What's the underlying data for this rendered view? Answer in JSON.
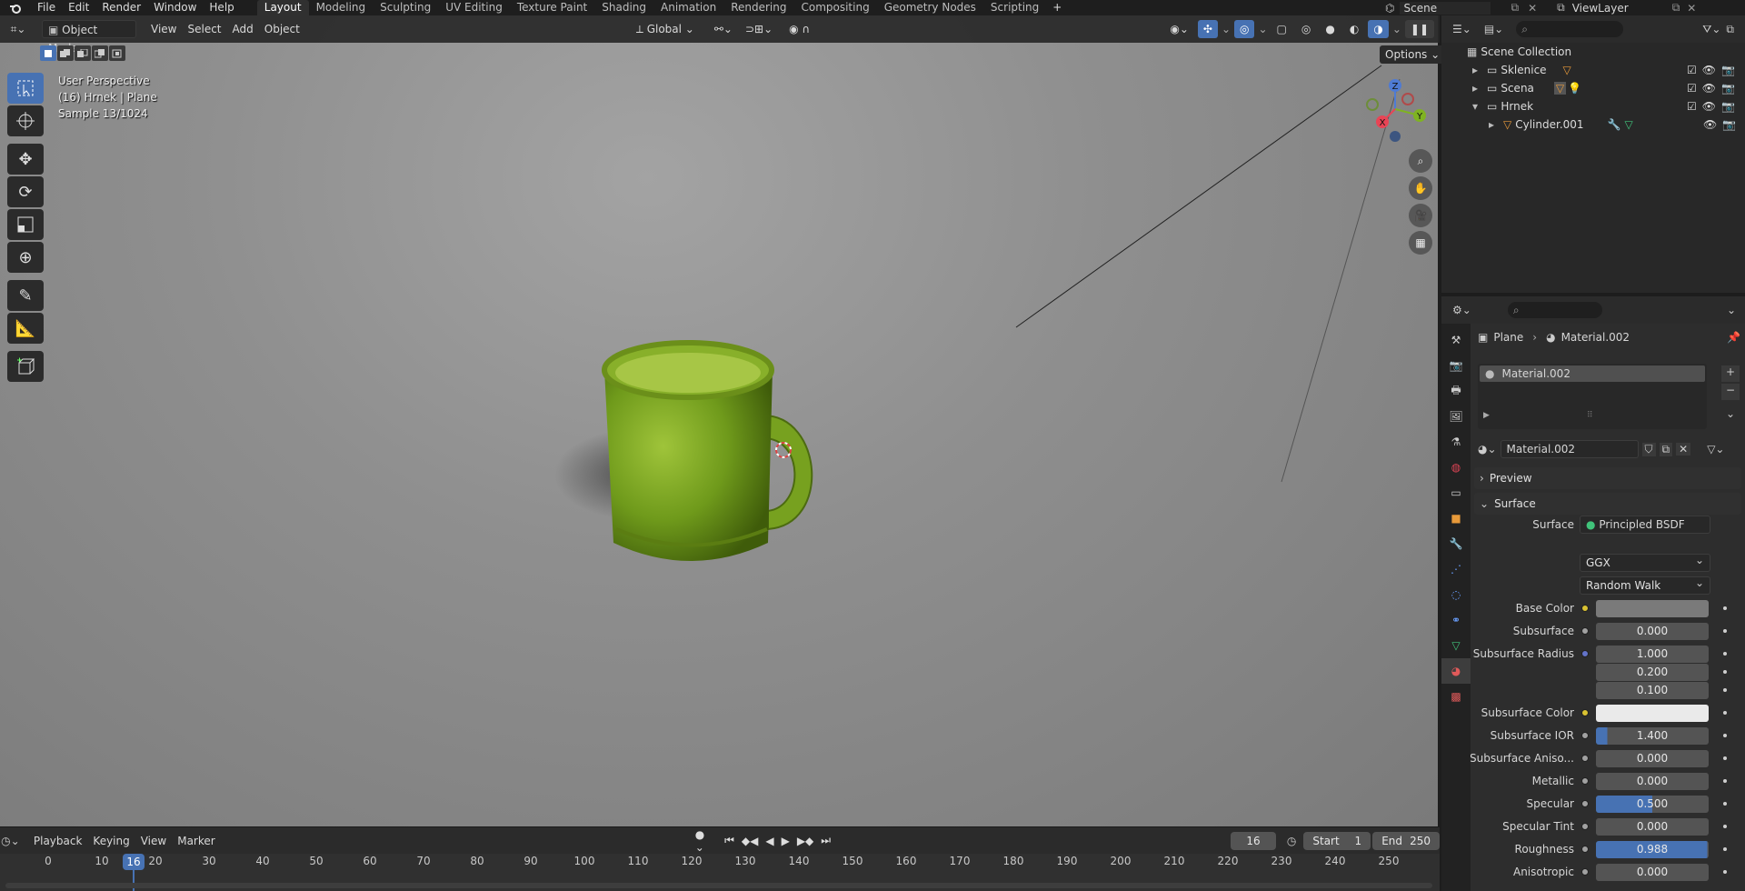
{
  "topbar": {
    "menu": [
      "File",
      "Edit",
      "Render",
      "Window",
      "Help"
    ],
    "workspaces": [
      "Layout",
      "Modeling",
      "Sculpting",
      "UV Editing",
      "Texture Paint",
      "Shading",
      "Animation",
      "Rendering",
      "Compositing",
      "Geometry Nodes",
      "Scripting"
    ],
    "active_workspace": "Layout",
    "add_tab": "+",
    "scene_name": "Scene",
    "view_layer": "ViewLayer"
  },
  "viewport_header": {
    "mode": "Object Mode",
    "menus": [
      "View",
      "Select",
      "Add",
      "Object"
    ],
    "transform_orientation": "Global",
    "options": "Options"
  },
  "viewport_overlay": {
    "perspective": "User Perspective",
    "object_info": "(16) Hrnek | Plane",
    "sample": "Sample 13/1024"
  },
  "gizmo": {
    "x": "X",
    "y": "Y",
    "z": "Z"
  },
  "timeline": {
    "menus": [
      "Playback",
      "Keying",
      "View",
      "Marker"
    ],
    "current_frame": "16",
    "start_label": "Start",
    "start_value": "1",
    "end_label": "End",
    "end_value": "250",
    "ticks": [
      "0",
      "10",
      "20",
      "30",
      "40",
      "50",
      "60",
      "70",
      "80",
      "90",
      "100",
      "110",
      "120",
      "130",
      "140",
      "150",
      "160",
      "170",
      "180",
      "190",
      "200",
      "210",
      "220",
      "230",
      "240",
      "250"
    ],
    "playhead": "16"
  },
  "outliner": {
    "root": "Scene Collection",
    "items": [
      {
        "name": "Sklenice",
        "level": 1,
        "expanded": false
      },
      {
        "name": "Scena",
        "level": 1,
        "expanded": false
      },
      {
        "name": "Hrnek",
        "level": 1,
        "expanded": true
      },
      {
        "name": "Cylinder.001",
        "level": 2,
        "expanded": false
      }
    ]
  },
  "properties": {
    "breadcrumb_object": "Plane",
    "breadcrumb_material": "Material.002",
    "slot_name": "Material.002",
    "material_name": "Material.002",
    "panel_preview": "Preview",
    "panel_surface": "Surface",
    "surface_label": "Surface",
    "surface_shader": "Principled BSDF",
    "distribution": "GGX",
    "subsurface_method": "Random Walk",
    "fields": [
      {
        "label": "Base Color",
        "value": "",
        "type": "color",
        "color": "#7a7a7a",
        "dot": "#d9c232"
      },
      {
        "label": "Subsurface",
        "value": "0.000",
        "type": "num",
        "dot": "#a1a1a1"
      },
      {
        "label": "Subsurface Radius",
        "value": "1.000",
        "type": "num",
        "dot": "#6373c9"
      },
      {
        "label": "",
        "value": "0.200",
        "type": "num"
      },
      {
        "label": "",
        "value": "0.100",
        "type": "num"
      },
      {
        "label": "Subsurface Color",
        "value": "",
        "type": "color",
        "color": "#eaeaea",
        "dot": "#d9c232"
      },
      {
        "label": "Subsurface IOR",
        "value": "1.400",
        "type": "num",
        "dot": "#a1a1a1",
        "fill": 0.1
      },
      {
        "label": "Subsurface Aniso...",
        "value": "0.000",
        "type": "num",
        "dot": "#a1a1a1"
      },
      {
        "label": "Metallic",
        "value": "0.000",
        "type": "num",
        "dot": "#a1a1a1"
      },
      {
        "label": "Specular",
        "value": "0.500",
        "type": "num",
        "dot": "#a1a1a1",
        "fill": 0.5
      },
      {
        "label": "Specular Tint",
        "value": "0.000",
        "type": "num",
        "dot": "#a1a1a1"
      },
      {
        "label": "Roughness",
        "value": "0.988",
        "type": "num",
        "dot": "#a1a1a1",
        "fill": 0.988
      },
      {
        "label": "Anisotropic",
        "value": "0.000",
        "type": "num",
        "dot": "#a1a1a1"
      }
    ]
  },
  "colors": {
    "accent": "#4772b3",
    "mug": "#6f9a1b"
  }
}
